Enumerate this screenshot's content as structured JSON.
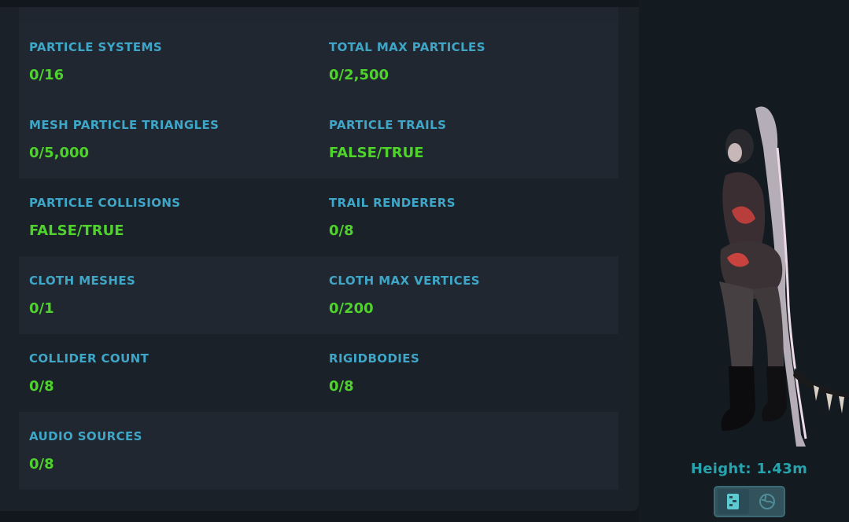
{
  "stats": [
    [
      {
        "label": "PARTICLE SYSTEMS",
        "value": "0/16"
      },
      {
        "label": "TOTAL MAX PARTICLES",
        "value": "0/2,500"
      }
    ],
    [
      {
        "label": "MESH PARTICLE TRIANGLES",
        "value": "0/5,000"
      },
      {
        "label": "PARTICLE TRAILS",
        "value": "FALSE/TRUE"
      }
    ],
    [
      {
        "label": "PARTICLE COLLISIONS",
        "value": "FALSE/TRUE"
      },
      {
        "label": "TRAIL RENDERERS",
        "value": "0/8"
      }
    ],
    [
      {
        "label": "CLOTH MESHES",
        "value": "0/1"
      },
      {
        "label": "CLOTH MAX VERTICES",
        "value": "0/200"
      }
    ],
    [
      {
        "label": "COLLIDER COUNT",
        "value": "0/8"
      },
      {
        "label": "RIGIDBODIES",
        "value": "0/8"
      }
    ],
    [
      {
        "label": "AUDIO SOURCES",
        "value": "0/8"
      }
    ]
  ],
  "avatar_preview": {
    "height_text": "Height: 1.43m",
    "toggle_icons": [
      "book-icon",
      "globe-icon"
    ]
  },
  "colors": {
    "label": "#3fa6c7",
    "value": "#4fd22c",
    "height_text": "#27a3ae"
  }
}
